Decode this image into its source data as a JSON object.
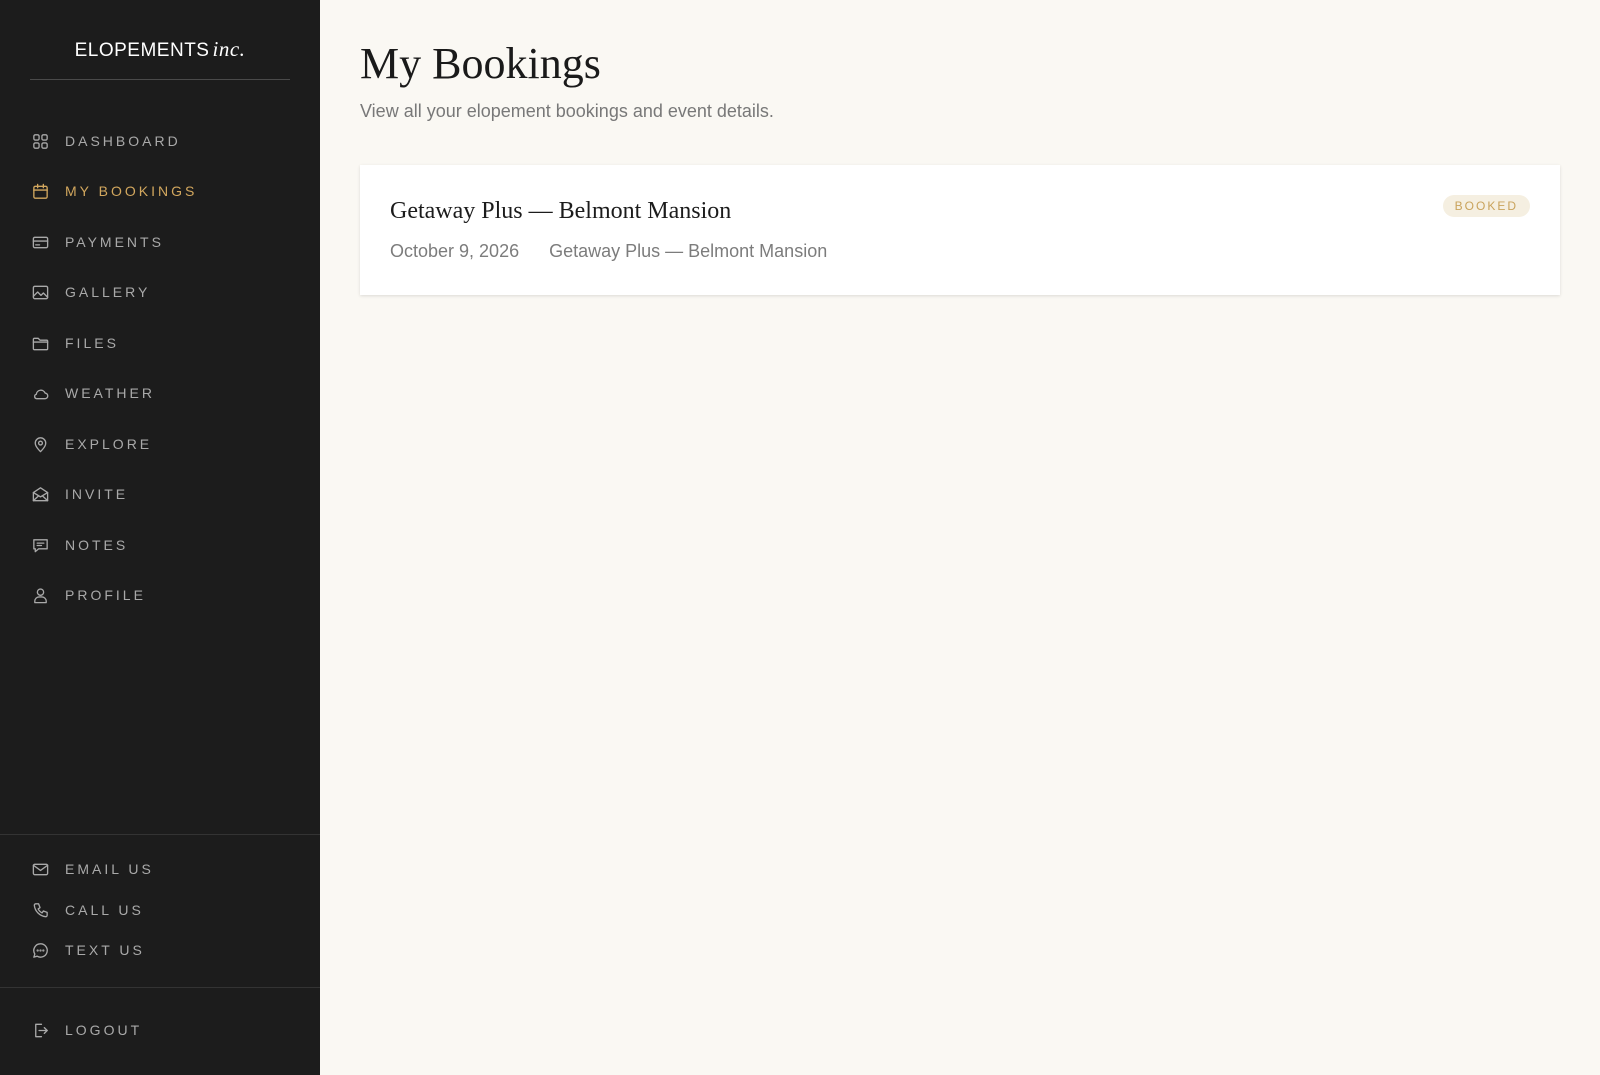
{
  "brand": {
    "name": "ELOPEMENTS",
    "suffix": "inc."
  },
  "nav": {
    "items": [
      {
        "label": "DASHBOARD",
        "icon": "grid-icon",
        "active": false
      },
      {
        "label": "MY BOOKINGS",
        "icon": "calendar-icon",
        "active": true
      },
      {
        "label": "PAYMENTS",
        "icon": "credit-card-icon",
        "active": false
      },
      {
        "label": "GALLERY",
        "icon": "image-icon",
        "active": false
      },
      {
        "label": "FILES",
        "icon": "folder-icon",
        "active": false
      },
      {
        "label": "WEATHER",
        "icon": "cloud-icon",
        "active": false
      },
      {
        "label": "EXPLORE",
        "icon": "map-pin-icon",
        "active": false
      },
      {
        "label": "INVITE",
        "icon": "envelope-open-icon",
        "active": false
      },
      {
        "label": "NOTES",
        "icon": "message-square-icon",
        "active": false
      },
      {
        "label": "PROFILE",
        "icon": "user-icon",
        "active": false
      }
    ],
    "contact": [
      {
        "label": "EMAIL US",
        "icon": "mail-icon"
      },
      {
        "label": "CALL US",
        "icon": "phone-icon"
      },
      {
        "label": "TEXT US",
        "icon": "chat-bubble-icon"
      }
    ],
    "logout": {
      "label": "LOGOUT",
      "icon": "logout-icon"
    }
  },
  "page": {
    "title": "My Bookings",
    "subtitle": "View all your elopement bookings and event details."
  },
  "bookings": [
    {
      "title": "Getaway Plus — Belmont Mansion",
      "date": "October 9, 2026",
      "venue": "Getaway Plus — Belmont Mansion",
      "status": "BOOKED"
    }
  ],
  "colors": {
    "sidebar_bg": "#1c1c1c",
    "accent": "#d2a75e",
    "page_bg": "#faf8f3",
    "badge_bg": "#f5efe1",
    "badge_text": "#c9a35c"
  }
}
